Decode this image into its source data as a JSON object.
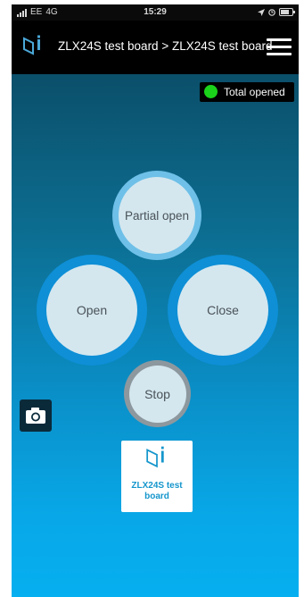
{
  "status_bar": {
    "carrier": "EE",
    "network": "4G",
    "time": "15:29"
  },
  "nav": {
    "title": "ZLX24S test board > ZLX24S test board"
  },
  "status_badge": {
    "text": "Total opened",
    "led_color": "#1bd21b"
  },
  "controls": {
    "partial_open": "Partial open",
    "open": "Open",
    "close": "Close",
    "stop": "Stop"
  },
  "device_card": {
    "name": "ZLX24S test board"
  },
  "colors": {
    "brand_blue": "#1596cc",
    "ring_blue": "#0e8fd6",
    "ring_light": "#6ec0e8",
    "ring_grey": "#8d989e",
    "button_face": "#d4e7ef"
  },
  "icons": {
    "logo": "brand-logo-icon",
    "menu": "hamburger-menu-icon",
    "camera": "camera-icon",
    "location": "location-arrow-icon",
    "battery": "battery-icon"
  }
}
